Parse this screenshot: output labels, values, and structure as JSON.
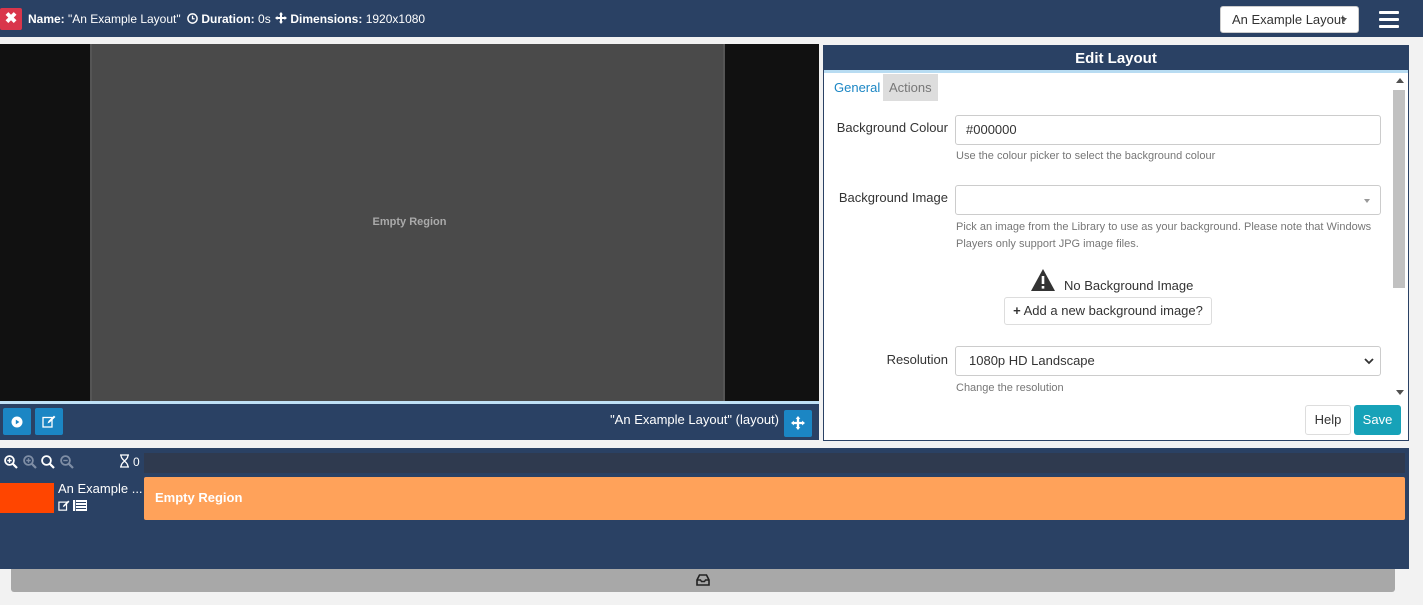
{
  "topbar": {
    "close_symbol": "✖",
    "name_label": "Name:",
    "name_value": "\"An Example Layout\"",
    "duration_label": "Duration:",
    "duration_value": "0s",
    "dimensions_label": "Dimensions:",
    "dimensions_value": "1920x1080",
    "layout_select_value": "An Example Layout",
    "icons": [
      "close-icon",
      "clock-icon",
      "move-icon",
      "hamburger-icon"
    ]
  },
  "preview": {
    "region_label": "Empty Region",
    "layout_title": "\"An Example Layout\" (layout)",
    "icons": [
      "play-icon",
      "edit-icon",
      "move-icon"
    ]
  },
  "edit_layout": {
    "title": "Edit Layout",
    "tabs": [
      {
        "label": "General",
        "active": true
      },
      {
        "label": "Actions",
        "active": false
      }
    ],
    "background_colour": {
      "label": "Background Colour",
      "value": "#000000",
      "help": "Use the colour picker to select the background colour"
    },
    "background_image": {
      "label": "Background Image",
      "value": "",
      "help": "Pick an image from the Library to use as your background. Please note that Windows Players only support JPG image files.",
      "help_line1": "Pick an image from the Library to use as your background. Please note that Windows",
      "help_line2": "Players only support JPG image files.",
      "none_text": "No Background Image",
      "add_button": "Add a new background image?"
    },
    "resolution": {
      "label": "Resolution",
      "value": "1080p HD Landscape",
      "help": "Change the resolution"
    },
    "help_button": "Help",
    "save_button": "Save"
  },
  "timeline": {
    "duration_count": "0",
    "region_name": "An Example ...",
    "region_bar_label": "Empty Region",
    "region_color": "#ff4500",
    "bar_color": "#ffa25a",
    "icons": [
      "zoom-in-icon",
      "zoom-out-icon",
      "zoom-reset-icon",
      "zoom-fit-icon",
      "hourglass-icon",
      "edit-icon",
      "list-icon",
      "drawer-icon"
    ]
  },
  "colors": {
    "header_bg": "#2a4164",
    "accent_blue": "#1b86c4",
    "save_teal": "#17a2b8",
    "close_red": "#d9364b"
  }
}
